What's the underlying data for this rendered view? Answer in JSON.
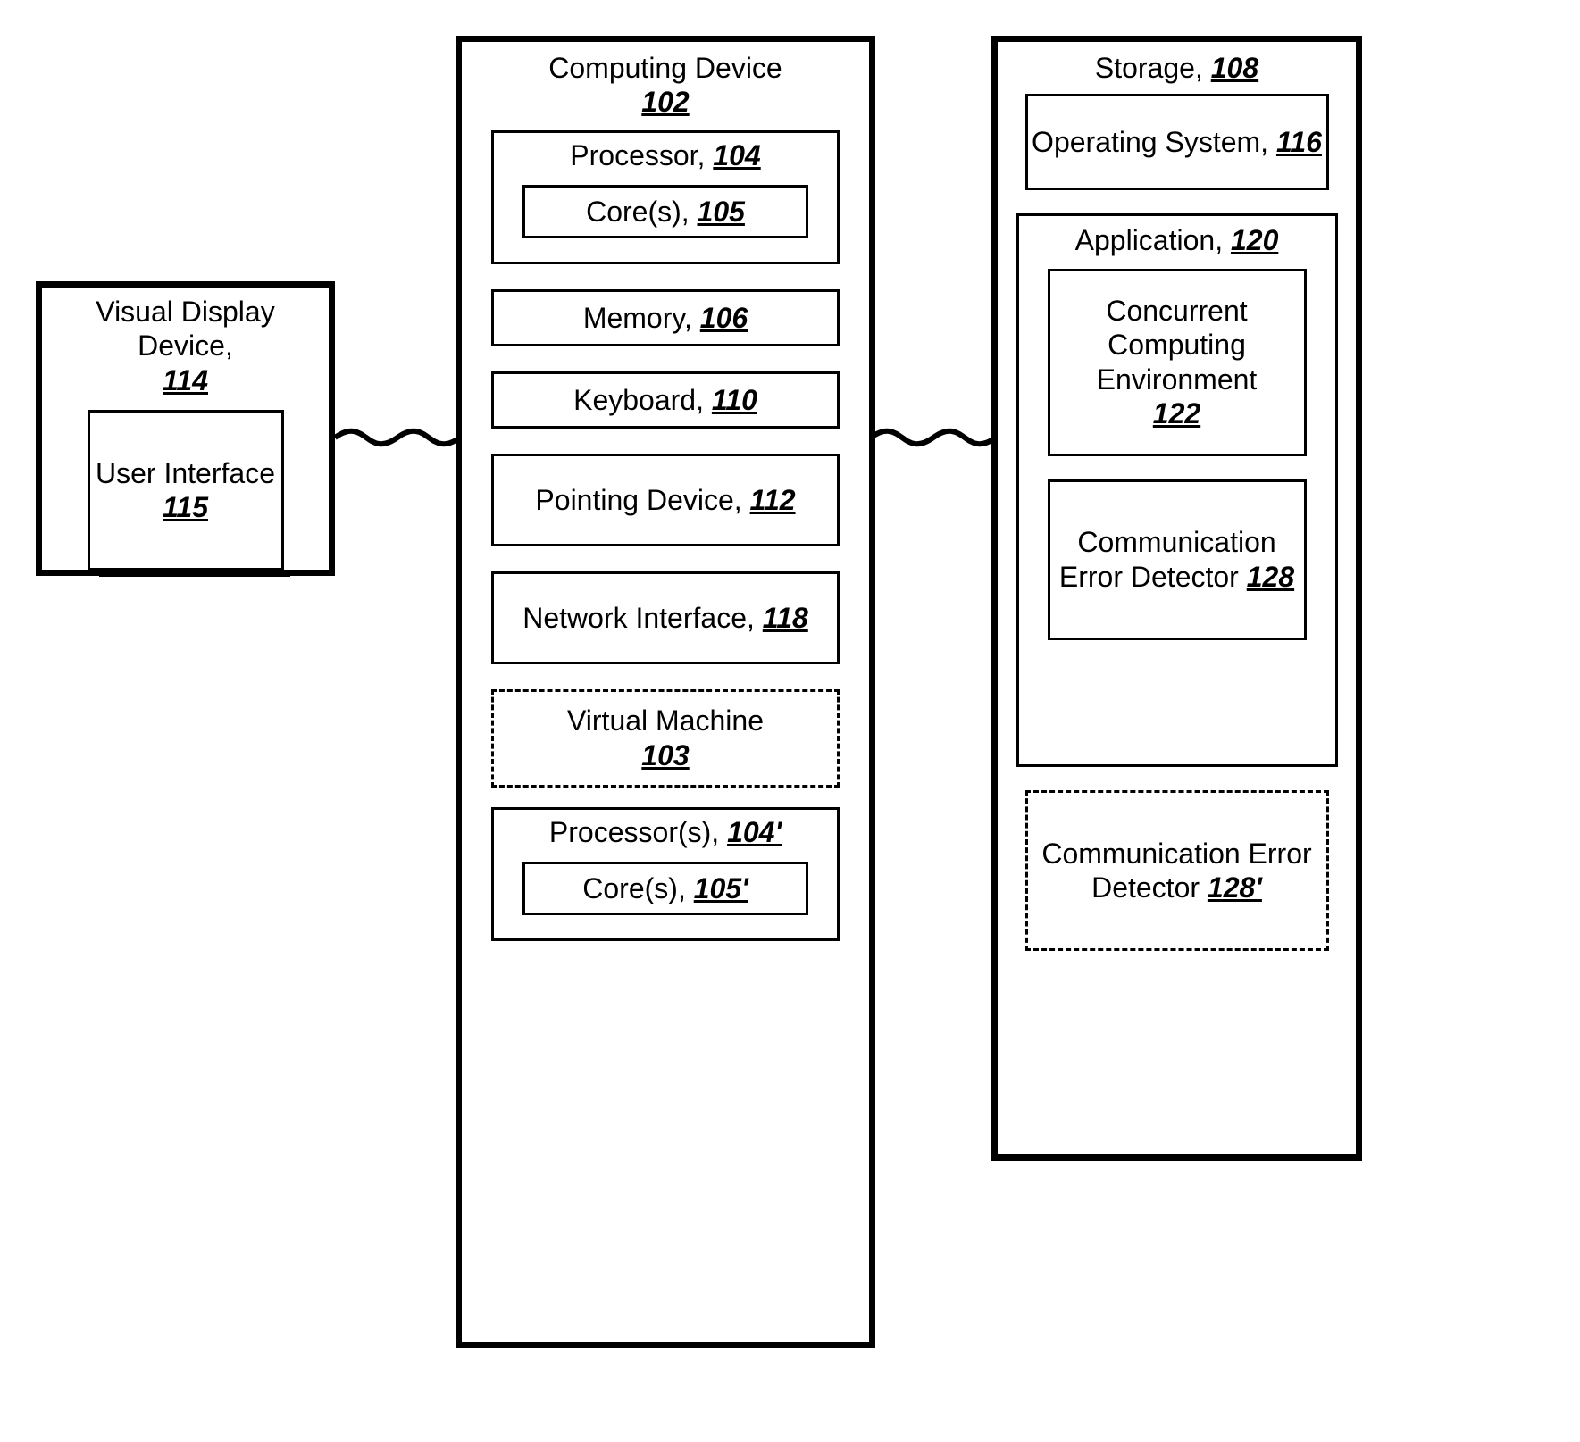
{
  "display": {
    "title": "Visual Display Device,",
    "ref": "114",
    "ui_label": "User Interface",
    "ui_ref": "115"
  },
  "computing": {
    "title": "Computing Device",
    "ref": "102",
    "processor_label": "Processor,",
    "processor_ref": "104",
    "cores_label": "Core(s),",
    "cores_ref": "105",
    "memory_label": "Memory,",
    "memory_ref": "106",
    "keyboard_label": "Keyboard,",
    "keyboard_ref": "110",
    "pointing_label": "Pointing Device,",
    "pointing_ref": "112",
    "network_label": "Network Interface,",
    "network_ref": "118",
    "vm_label": "Virtual Machine",
    "vm_ref": "103",
    "processors2_label": "Processor(s),",
    "processors2_ref": "104'",
    "cores2_label": "Core(s),",
    "cores2_ref": "105'"
  },
  "storage": {
    "title": "Storage,",
    "ref": "108",
    "os_label": "Operating System,",
    "os_ref": "116",
    "app_label": "Application,",
    "app_ref": "120",
    "cce_label": "Concurrent Computing Environment",
    "cce_ref": "122",
    "ced_label": "Communication Error Detector",
    "ced_ref": "128",
    "ced2_label": "Communication Error Detector",
    "ced2_ref": "128'"
  }
}
